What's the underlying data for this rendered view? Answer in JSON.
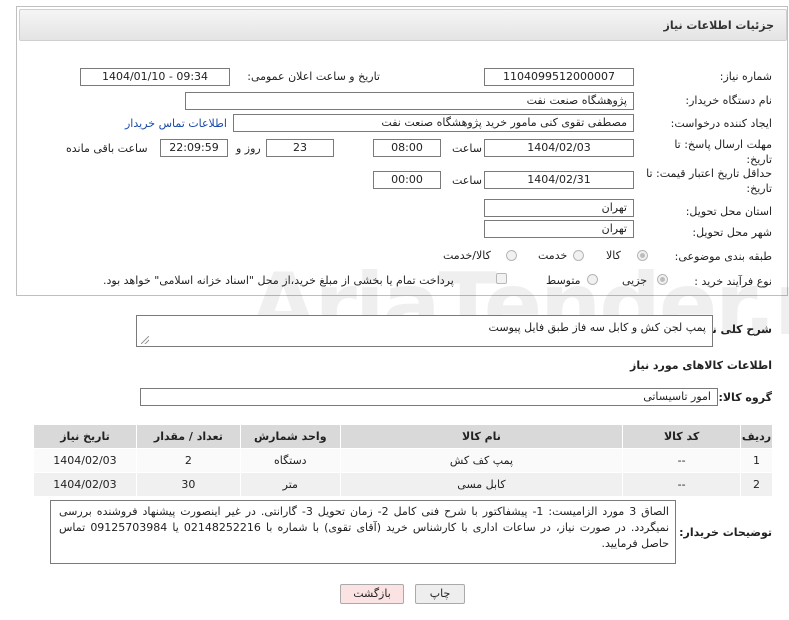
{
  "header": {
    "title": "جزئیات اطلاعات نیاز"
  },
  "fields": {
    "need_number_label": "شماره نیاز:",
    "need_number": "1104099512000007",
    "announce_label": "تاریخ و ساعت اعلان عمومی:",
    "announce_value": "1404/01/10 - 09:34",
    "buyer_org_label": "نام دستگاه خریدار:",
    "buyer_org": "پژوهشگاه صنعت نفت",
    "requester_label": "ایجاد کننده درخواست:",
    "requester": "مصطفی تقوی کنی مامور خرید پژوهشگاه صنعت نفت",
    "contact_link": "اطلاعات تماس خریدار",
    "deadline_label": "مهلت ارسال پاسخ: تا تاریخ:",
    "deadline_date": "1404/02/03",
    "deadline_time_label": "ساعت",
    "deadline_time": "08:00",
    "days_value": "23",
    "days_label": "روز و",
    "remaining_time": "22:09:59",
    "remaining_label": "ساعت باقی مانده",
    "price_validity_label": "حداقل تاریخ اعتبار قیمت: تا تاریخ:",
    "price_validity_date": "1404/02/31",
    "price_validity_time_label": "ساعت",
    "price_validity_time": "00:00",
    "province_label": "استان محل تحویل:",
    "province": "تهران",
    "city_label": "شهر محل تحویل:",
    "city": "تهران",
    "category_label": "طبقه بندی موضوعی:",
    "category_options": [
      "کالا",
      "خدمت",
      "کالا/خدمت"
    ],
    "process_label": "نوع فرآیند خرید :",
    "process_options": [
      "جزیی",
      "متوسط"
    ],
    "payment_note": "پرداخت تمام یا بخشی از مبلغ خرید،از محل \"اسناد خزانه اسلامی\" خواهد بود."
  },
  "description": {
    "label": "شرح کلی نیاز:",
    "value": "پمپ لجن کش و کابل سه فاز طبق فایل پیوست"
  },
  "goods": {
    "section_title": "اطلاعات کالاهای مورد نیاز",
    "group_label": "گروه کالا:",
    "group_value": "امور تاسیساتی",
    "columns": [
      "ردیف",
      "کد کالا",
      "نام کالا",
      "واحد شمارش",
      "تعداد / مقدار",
      "تاریخ نیاز"
    ],
    "rows": [
      {
        "row": "1",
        "code": "--",
        "name": "پمپ کف کش",
        "unit": "دستگاه",
        "qty": "2",
        "date": "1404/02/03"
      },
      {
        "row": "2",
        "code": "--",
        "name": "کابل مسی",
        "unit": "متر",
        "qty": "30",
        "date": "1404/02/03"
      }
    ]
  },
  "buyer_notes": {
    "label": "توضیحات خریدار:",
    "value": "الصاق 3 مورد الزامیست: 1- پیشفاکتور با شرح فنی کامل 2- زمان تحویل 3- گارانتی. در غیر اینصورت پیشنهاد فروشنده بررسی نمیگردد. در صورت نیاز، در ساعات اداری با کارشناس خرید (آقای تقوی) با شماره با 02148252216 یا 09125703984 تماس حاصل فرمایید."
  },
  "buttons": {
    "print": "چاپ",
    "back": "بازگشت"
  },
  "watermark": "AriaTender.neT",
  "colors": {
    "link": "#1a4aa8",
    "back_button_bg": "#fbe3e3",
    "print_button_bg": "#eeeeee"
  }
}
